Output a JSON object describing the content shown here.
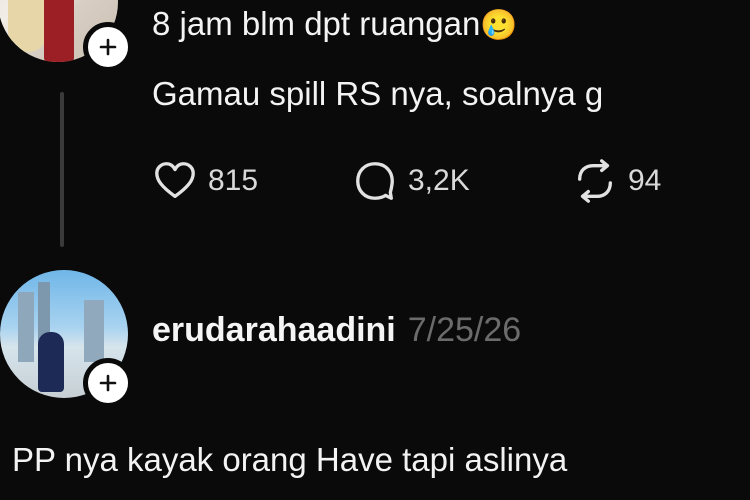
{
  "post": {
    "line1": "8 jam blm dpt ruangan",
    "emoji": "🥲",
    "line2": "Gamau spill RS nya, soalnya g",
    "actions": {
      "likes": "815",
      "replies": "3,2K",
      "reposts": "94"
    }
  },
  "reply": {
    "username": "erudarahaadini",
    "date": "7/25/26",
    "text": "PP nya kayak orang Have tapi aslinya"
  },
  "icons": {
    "plus": "plus-icon",
    "like": "heart-icon",
    "reply": "comment-icon",
    "repost": "repost-icon"
  }
}
